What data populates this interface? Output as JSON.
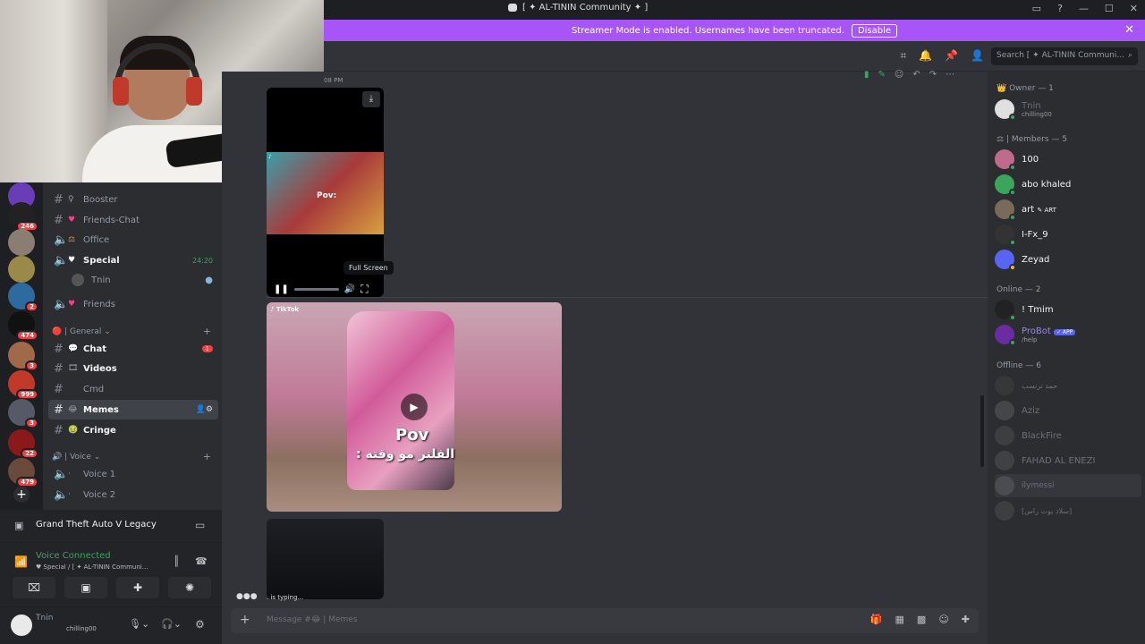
{
  "window": {
    "title": "[ ✦ AL-TININ Community ✦ ]"
  },
  "banner": {
    "text": "Streamer Mode is enabled. Usernames have been truncated.",
    "button": "Disable"
  },
  "header": {
    "search_placeholder": "Search",
    "search_server": "[ ✦ AL-TININ Communi..."
  },
  "servers": [
    {
      "badge": ""
    },
    {
      "badge": "246"
    },
    {
      "badge": ""
    },
    {
      "badge": ""
    },
    {
      "badge": "2"
    },
    {
      "badge": "474"
    },
    {
      "badge": "3"
    },
    {
      "badge": "999"
    },
    {
      "badge": "3"
    },
    {
      "badge": "22"
    },
    {
      "badge": "479"
    }
  ],
  "channels": {
    "items": [
      {
        "label": "Booster",
        "emoji": "♀",
        "type": "text"
      },
      {
        "label": "Friends-Chat",
        "emoji": "♥",
        "type": "text"
      },
      {
        "label": "Office",
        "emoji": "⚖",
        "type": "voice"
      },
      {
        "label": "Special",
        "emoji": "♥",
        "type": "voice",
        "time": "24:20"
      },
      {
        "label": "Friends",
        "emoji": "♥",
        "type": "voice"
      }
    ],
    "voice_user": "Tnin",
    "category_general": "General",
    "general": [
      {
        "label": "Chat",
        "badge": "1"
      },
      {
        "label": "Videos"
      },
      {
        "label": "Cmd"
      },
      {
        "label": "Memes"
      },
      {
        "label": "Cringe"
      }
    ],
    "category_voice": "Voice",
    "voice": [
      {
        "label": "Voice 1"
      },
      {
        "label": "Voice 2"
      }
    ]
  },
  "activity": {
    "game": "Grand Theft Auto V Legacy"
  },
  "voice_panel": {
    "status": "Voice Connected",
    "channel": "♥ Special / [ ✦ AL-TININ Communi..."
  },
  "user_panel": {
    "name": "Tnin",
    "status": "chilling00"
  },
  "chat": {
    "timestamp": "08 PM",
    "tooltip": "Full Screen",
    "tiktok": "TikTok",
    "overlay_pov": "Pov",
    "overlay_ar": ": الفلتر مو وقته",
    "typing": ". is typing...",
    "composer_placeholder": "Message #",
    "composer_channel": "Memes"
  },
  "members": {
    "owner_header": "Owner — 1",
    "owner": [
      {
        "name": "Tnin",
        "sub": "chilling00"
      }
    ],
    "members_header": "| Members — 5",
    "members": [
      {
        "name": "100",
        "color": "#c06a8a"
      },
      {
        "name": "abo khaled",
        "color": "#3ba55c"
      },
      {
        "name": "art",
        "tag": "ART",
        "color": "#7a6a5a"
      },
      {
        "name": "I-Fx_9",
        "color": "#333"
      },
      {
        "name": "Zeyad",
        "color": "#5865f2"
      }
    ],
    "online_header": "Online — 2",
    "online": [
      {
        "name": "! Tmim",
        "color": "#222"
      },
      {
        "name": "ProBot",
        "sub": "/help",
        "tag": "APP",
        "color": "#6a2ca0"
      }
    ],
    "offline_header": "Offline — 6",
    "offline": [
      {
        "name": "حمد ترنسب"
      },
      {
        "name": "Aziz"
      },
      {
        "name": "BlackFire"
      },
      {
        "name": "FAHAD AL ENEZI"
      },
      {
        "name": "ilymessi"
      },
      {
        "name": "[سلاد يوت راس]"
      }
    ]
  }
}
